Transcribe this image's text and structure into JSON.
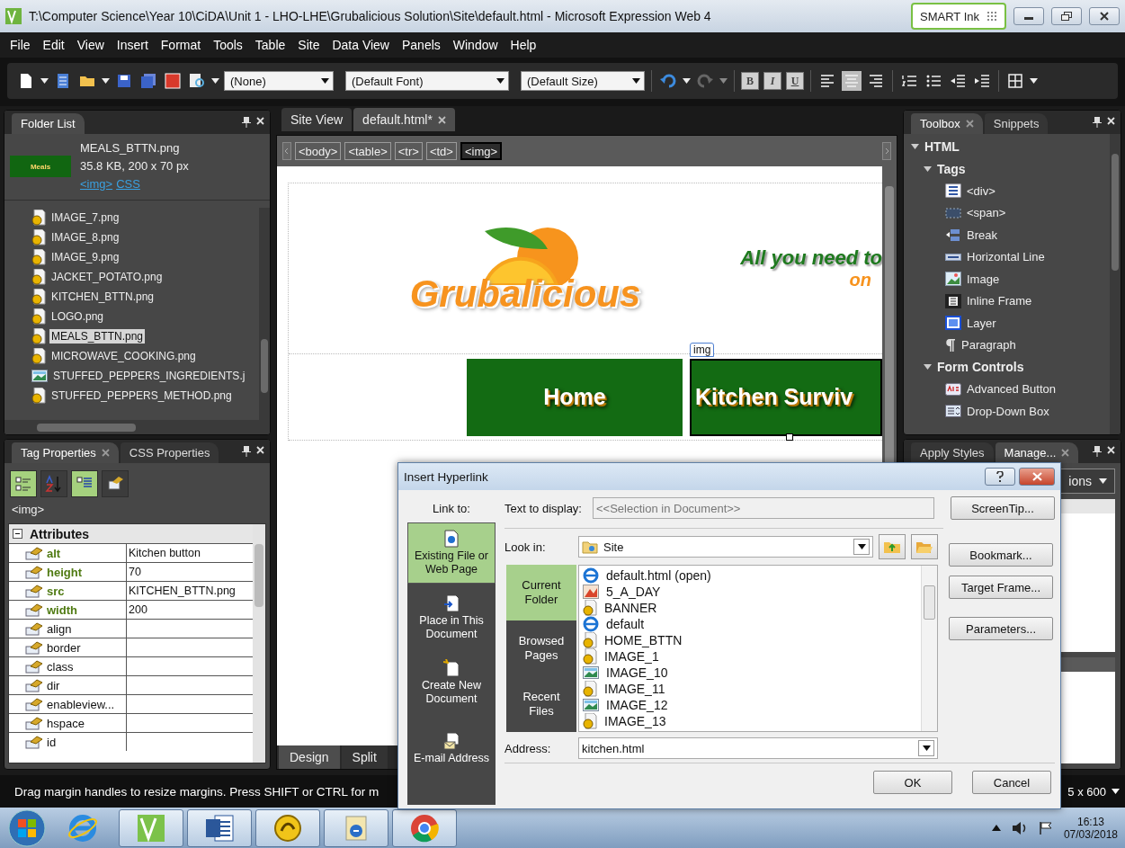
{
  "window": {
    "title": "T:\\Computer Science\\Year 10\\CiDA\\Unit 1 - LHO-LHE\\Grubalicious Solution\\Site\\default.html - Microsoft Expression Web 4",
    "smart_ink": "SMART Ink"
  },
  "menu": [
    "File",
    "Edit",
    "View",
    "Insert",
    "Format",
    "Tools",
    "Table",
    "Site",
    "Data View",
    "Panels",
    "Window",
    "Help"
  ],
  "toolbar": {
    "style_select": "(None)",
    "font_select": "(Default Font)",
    "size_select": "(Default Size)",
    "format_buttons": [
      "B",
      "I",
      "U"
    ],
    "align_buttons": [
      {
        "kind": "left",
        "selected": false
      },
      {
        "kind": "center",
        "selected": true
      },
      {
        "kind": "right",
        "selected": false
      }
    ]
  },
  "folder_list": {
    "title": "Folder List",
    "preview": {
      "thumb_text": "Meals",
      "file_name": "MEALS_BTTN.png",
      "details": "35.8 KB, 200 x 70 px",
      "links": [
        "<img>",
        "CSS"
      ]
    },
    "files": [
      {
        "name": "IMAGE_7.png",
        "kind": "png",
        "selected": false
      },
      {
        "name": "IMAGE_8.png",
        "kind": "png",
        "selected": false
      },
      {
        "name": "IMAGE_9.png",
        "kind": "png",
        "selected": false
      },
      {
        "name": "JACKET_POTATO.png",
        "kind": "png",
        "selected": false
      },
      {
        "name": "KITCHEN_BTTN.png",
        "kind": "png",
        "selected": false
      },
      {
        "name": "LOGO.png",
        "kind": "png",
        "selected": false
      },
      {
        "name": "MEALS_BTTN.png",
        "kind": "png",
        "selected": true
      },
      {
        "name": "MICROWAVE_COOKING.png",
        "kind": "png",
        "selected": false
      },
      {
        "name": "STUFFED_PEPPERS_INGREDIENTS.j",
        "kind": "picture",
        "selected": false
      },
      {
        "name": "STUFFED_PEPPERS_METHOD.png",
        "kind": "png",
        "selected": false
      }
    ]
  },
  "tag_properties": {
    "tabs": [
      {
        "label": "Tag Properties",
        "selected": true
      },
      {
        "label": "CSS Properties",
        "selected": false
      }
    ],
    "view_buttons": [
      {
        "kind": "categorized",
        "selected": true
      },
      {
        "kind": "sort",
        "selected": false
      },
      {
        "kind": "set-first",
        "selected": true
      },
      {
        "kind": "tag",
        "selected": false
      }
    ],
    "tag": "<img>",
    "group": {
      "label": "Attributes",
      "expanded": true
    },
    "attributes": [
      {
        "name": "alt",
        "value": "Kitchen button",
        "set": true
      },
      {
        "name": "height",
        "value": "70",
        "set": true
      },
      {
        "name": "src",
        "value": "KITCHEN_BTTN.png",
        "set": true
      },
      {
        "name": "width",
        "value": "200",
        "set": true
      },
      {
        "name": "align",
        "set": false
      },
      {
        "name": "border",
        "set": false
      },
      {
        "name": "class",
        "set": false
      },
      {
        "name": "dir",
        "set": false
      },
      {
        "name": "enableview...",
        "set": false
      },
      {
        "name": "hspace",
        "set": false
      },
      {
        "name": "id",
        "set": false
      }
    ]
  },
  "editor": {
    "tabs": [
      {
        "label": "Site View",
        "selected": false,
        "closable": false
      },
      {
        "label": "default.html*",
        "selected": true,
        "closable": true
      }
    ],
    "breadcrumb": [
      {
        "label": "<body>",
        "selected": false
      },
      {
        "label": "<table>",
        "selected": false
      },
      {
        "label": "<tr>",
        "selected": false
      },
      {
        "label": "<td>",
        "selected": false
      },
      {
        "label": "<img>",
        "selected": true
      }
    ],
    "page": {
      "logo": "Grubalicious",
      "slogan_line_1": "All you need to",
      "slogan_line_2": "on",
      "selection_tag": "img",
      "nav": [
        {
          "label": "Home",
          "selected": false
        },
        {
          "label": "Kitchen Surviv",
          "selected": true
        }
      ]
    },
    "view_tabs": [
      {
        "label": "Design",
        "selected": true
      },
      {
        "label": "Split",
        "selected": false
      }
    ]
  },
  "toolbox": {
    "tabs": [
      {
        "label": "Toolbox",
        "selected": true,
        "closable": true
      },
      {
        "label": "Snippets",
        "selected": false,
        "closable": false
      }
    ],
    "tree": [
      {
        "label": "HTML",
        "expanded": true,
        "children": [
          {
            "label": "Tags",
            "expanded": true,
            "children": [
              {
                "label": "<div>",
                "kind": "div"
              },
              {
                "label": "<span>",
                "kind": "span"
              },
              {
                "label": "Break",
                "kind": "break"
              },
              {
                "label": "Horizontal Line",
                "kind": "hr"
              },
              {
                "label": "Image",
                "kind": "image"
              },
              {
                "label": "Inline Frame",
                "kind": "iframe"
              },
              {
                "label": "Layer",
                "kind": "layer"
              },
              {
                "label": "Paragraph",
                "kind": "paragraph"
              }
            ]
          },
          {
            "label": "Form Controls",
            "expanded": true,
            "children": [
              {
                "label": "Advanced Button",
                "kind": "button"
              },
              {
                "label": "Drop-Down Box",
                "kind": "dropdown"
              }
            ]
          }
        ]
      }
    ]
  },
  "styles_panel": {
    "tabs": [
      {
        "label": "Apply Styles",
        "selected": false,
        "closable": false
      },
      {
        "label": "Manage...",
        "selected": true,
        "closable": true
      }
    ],
    "options_button": "ions"
  },
  "status_bar": {
    "message": "Drag margin handles to resize margins. Press SHIFT or CTRL for m",
    "page_size": "5 x 600"
  },
  "taskbar": {
    "apps": [
      {
        "kind": "ie",
        "active": false
      },
      {
        "kind": "expression",
        "active": true
      },
      {
        "kind": "word",
        "active": true
      },
      {
        "kind": "yellow",
        "active": true
      },
      {
        "kind": "explorer",
        "active": true
      },
      {
        "kind": "chrome",
        "active": true
      }
    ],
    "time": "16:13",
    "date": "07/03/2018"
  },
  "dialog": {
    "title": "Insert Hyperlink",
    "link_to_label": "Link to:",
    "link_to": [
      {
        "label": "Existing File or Web Page",
        "kind": "file",
        "selected": true
      },
      {
        "label": "Place in This Document",
        "kind": "place",
        "selected": false
      },
      {
        "label": "Create New Document",
        "kind": "new",
        "selected": false
      },
      {
        "label": "E-mail Address",
        "kind": "email",
        "selected": false
      }
    ],
    "text_to_display_label": "Text to display:",
    "text_to_display": "<<Selection in Document>>",
    "look_in_label": "Look in:",
    "look_in": "Site",
    "locations": [
      {
        "label": "Current Folder",
        "selected": true
      },
      {
        "label": "Browsed Pages",
        "selected": false
      },
      {
        "label": "Recent Files",
        "selected": false
      }
    ],
    "files": [
      {
        "name": "default.html (open)",
        "kind": "web"
      },
      {
        "name": "5_A_DAY",
        "kind": "graphic"
      },
      {
        "name": "BANNER",
        "kind": "png"
      },
      {
        "name": "default",
        "kind": "web"
      },
      {
        "name": "HOME_BTTN",
        "kind": "png"
      },
      {
        "name": "IMAGE_1",
        "kind": "png"
      },
      {
        "name": "IMAGE_10",
        "kind": "picture"
      },
      {
        "name": "IMAGE_11",
        "kind": "png"
      },
      {
        "name": "IMAGE_12",
        "kind": "picture"
      },
      {
        "name": "IMAGE_13",
        "kind": "png"
      }
    ],
    "address_label": "Address:",
    "address": "kitchen.html",
    "side_buttons": [
      "ScreenTip...",
      "Bookmark...",
      "Target Frame...",
      "Parameters..."
    ],
    "ok": "OK",
    "cancel": "Cancel"
  }
}
